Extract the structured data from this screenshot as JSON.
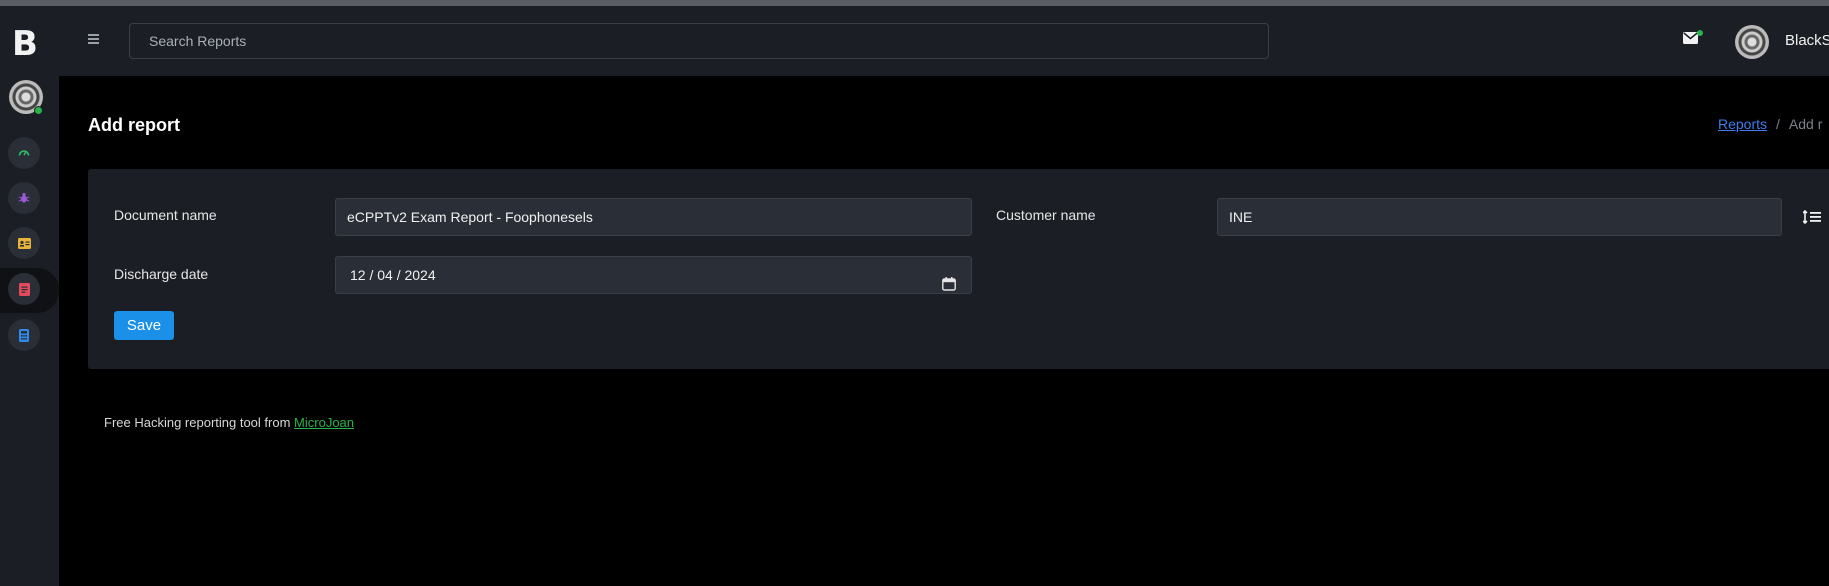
{
  "app": {
    "logo_letter": "B"
  },
  "header": {
    "search_placeholder": "Search Reports",
    "username": "BlackS"
  },
  "sidebar": {
    "items": [
      {
        "name": "dashboard",
        "icon": "gauge-icon",
        "color": "#2fbf6a"
      },
      {
        "name": "vulnerabilities",
        "icon": "bug-icon",
        "color": "#9b59d6"
      },
      {
        "name": "customers",
        "icon": "id-card-icon",
        "color": "#e8b33a"
      },
      {
        "name": "reports",
        "icon": "report-icon",
        "color": "#e24a5a"
      },
      {
        "name": "calculator",
        "icon": "calculator-icon",
        "color": "#2f8ae8"
      }
    ]
  },
  "page": {
    "title": "Add report",
    "breadcrumb": {
      "root": "Reports",
      "current": "Add r"
    }
  },
  "form": {
    "document_name_label": "Document name",
    "document_name_value": "eCPPTv2 Exam Report - Foophonesels",
    "customer_name_label": "Customer name",
    "customer_name_value": "INE",
    "discharge_date_label": "Discharge date",
    "discharge_date_value": "12 / 04 / 2024",
    "save_label": "Save"
  },
  "footer": {
    "text": "Free Hacking reporting tool from",
    "link": "MicroJoan"
  },
  "colors": {
    "accent": "#1a90e8",
    "link": "#3d7df0",
    "brand_green": "#29b34a"
  }
}
